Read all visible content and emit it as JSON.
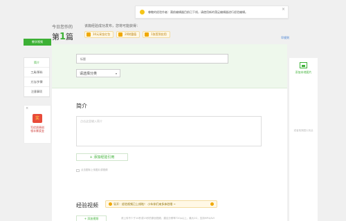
{
  "notice": {
    "text": "尊敬的经验作者：莆前编辑器目前已下线，请使用新的落足编辑器进行经验编辑。",
    "close": "×"
  },
  "today": {
    "label": "今日您作的",
    "prefix": "第",
    "number": "1",
    "suffix": "篇"
  },
  "rewards": {
    "label": "该篇经验成功发布，您将可能获得：",
    "items": [
      {
        "text": "10元采金红包",
        "icon": "red-packet-icon"
      },
      {
        "text": "20财富值",
        "icon": "coin-icon"
      },
      {
        "text": "1张签到应用",
        "icon": "card-icon"
      }
    ]
  },
  "rules_link": "早规则",
  "sidebar": {
    "button": "教学视频",
    "items": [
      {
        "label": "简介",
        "active": true
      },
      {
        "label": "工具/原料"
      },
      {
        "label": "方法/步骤"
      },
      {
        "label": "注意事项"
      }
    ],
    "promo": {
      "close": "×",
      "gift": "奖",
      "line1": "写优质原创",
      "line2": "领丰厚奖金"
    }
  },
  "form": {
    "title_placeholder": "标题",
    "category": "请选择分类",
    "category_arrow": "▾",
    "intro_title": "简介",
    "intro_placeholder": "点击这里输入简介",
    "add_reference": "+ 添加经验引用",
    "upload_note": "点击图标上传图片或视频",
    "video_title": "经验视频",
    "video_tip": "导开：经验视频已上线啦！ 小伙伴们来多体验哦 ~",
    "add_video": "+ 添加视频",
    "video_note": "请上传不少于10秒或15秒的原创视频，建议分辨率720p以上，最大2G，支持MP4/AVI"
  },
  "right_panel": {
    "add_image": "添加本地图片",
    "drop_hint": "或者拖拽图片到此"
  },
  "colors": {
    "accent": "#3cb035",
    "link": "#3d7bd2",
    "warning": "#f0a800"
  }
}
